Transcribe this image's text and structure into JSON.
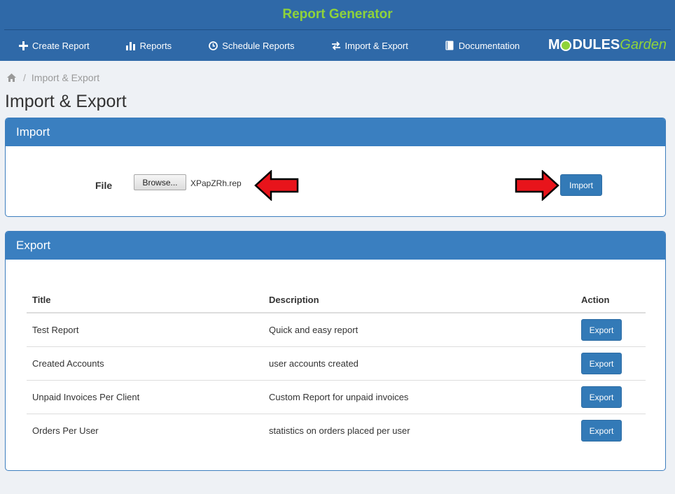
{
  "header": {
    "app_title": "Report Generator",
    "nav": [
      {
        "label": "Create Report",
        "icon": "plus-icon"
      },
      {
        "label": "Reports",
        "icon": "bar-chart-icon"
      },
      {
        "label": "Schedule Reports",
        "icon": "clock-icon"
      },
      {
        "label": "Import & Export",
        "icon": "exchange-icon"
      },
      {
        "label": "Documentation",
        "icon": "book-icon"
      }
    ],
    "logo_part1": "M",
    "logo_part2": "DULES",
    "logo_part3": "Garden"
  },
  "breadcrumb": {
    "separator": "/",
    "current": "Import & Export"
  },
  "page_title": "Import & Export",
  "import_panel": {
    "heading": "Import",
    "file_label": "File",
    "browse_label": "Browse...",
    "file_name": "XPapZRh.rep",
    "import_button": "Import"
  },
  "export_panel": {
    "heading": "Export",
    "columns": [
      "Title",
      "Description",
      "Action"
    ],
    "rows": [
      {
        "title": "Test Report",
        "description": "Quick and easy report",
        "action": "Export"
      },
      {
        "title": "Created Accounts",
        "description": "user accounts created",
        "action": "Export"
      },
      {
        "title": "Unpaid Invoices Per Client",
        "description": "Custom Report for unpaid invoices",
        "action": "Export"
      },
      {
        "title": "Orders Per User",
        "description": "statistics on orders placed per user",
        "action": "Export"
      }
    ]
  },
  "colors": {
    "header_bg": "#2f69a8",
    "title_green": "#8fd33a",
    "panel_head": "#3a7fc0",
    "button": "#337ab7",
    "arrow": "#e8141b"
  }
}
